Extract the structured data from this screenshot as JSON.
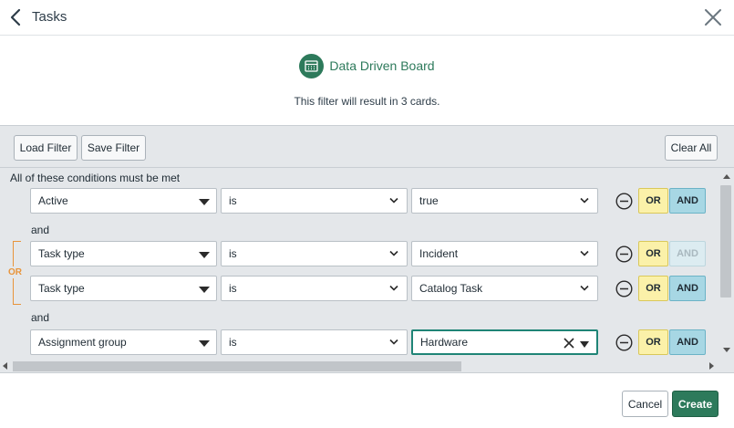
{
  "header": {
    "title": "Tasks",
    "back_icon": "chevron-left-icon",
    "close_icon": "close-icon"
  },
  "board": {
    "name": "Data Driven Board",
    "icon": "board-icon",
    "result_text": "This filter will result in 3 cards."
  },
  "toolbar": {
    "load_label": "Load Filter",
    "save_label": "Save Filter",
    "clear_label": "Clear All"
  },
  "conditions": {
    "heading": "All of these conditions must be met",
    "connector_and": "and",
    "or_bracket_label": "OR",
    "rows": [
      {
        "field": "Active",
        "operator": "is",
        "value": "true",
        "or_label": "OR",
        "and_label": "AND",
        "and_enabled": true
      },
      {
        "field": "Task type",
        "operator": "is",
        "value": "Incident",
        "or_label": "OR",
        "and_label": "AND",
        "and_enabled": false
      },
      {
        "field": "Task type",
        "operator": "is",
        "value": "Catalog Task",
        "or_label": "OR",
        "and_label": "AND",
        "and_enabled": true
      },
      {
        "field": "Assignment group",
        "operator": "is",
        "value": "Hardware",
        "or_label": "OR",
        "and_label": "AND",
        "and_enabled": true,
        "focused": true
      }
    ]
  },
  "footer": {
    "cancel_label": "Cancel",
    "create_label": "Create"
  },
  "colors": {
    "brand_green": "#2d7a5b",
    "or_yellow": "#fbf1a9",
    "and_blue": "#a7d7e4",
    "or_bracket_orange": "#e8943a",
    "focus_teal": "#1f8476"
  }
}
